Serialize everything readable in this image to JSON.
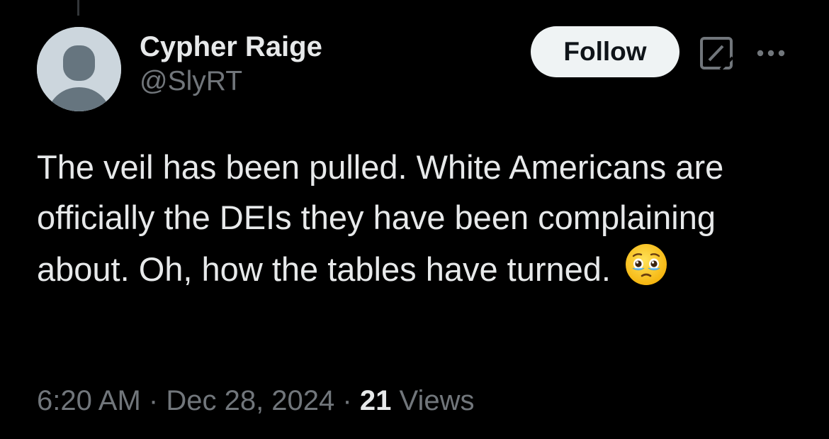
{
  "post": {
    "author": {
      "display_name": "Cypher Raige",
      "handle": "@SlyRT"
    },
    "follow_label": "Follow",
    "text": "The veil has been pulled. White Americans are officially the DEIs they have been complaining about. Oh, how the tables have turned.",
    "emoji": "face-holding-back-tears",
    "time": "6:20 AM",
    "separator": "·",
    "date": "Dec 28, 2024",
    "views_count": "21",
    "views_label": "Views"
  },
  "icons": {
    "avatar": "default-profile-avatar",
    "grok": "grok-icon",
    "more": "more-horizontal-icon"
  },
  "colors": {
    "background": "#000000",
    "primary_text": "#e7e9ea",
    "secondary_text": "#71767b",
    "follow_button_bg": "#eff3f4",
    "follow_button_text": "#0f1419",
    "avatar_bg": "#ccd6dd",
    "avatar_figure": "#66757f"
  }
}
